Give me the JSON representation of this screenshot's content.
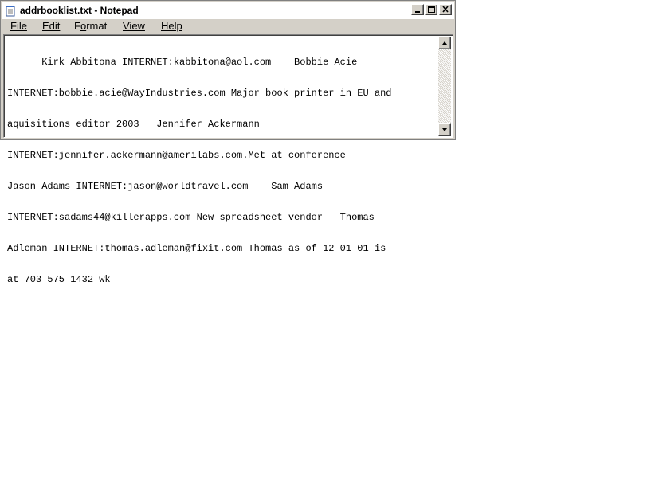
{
  "window": {
    "title": "addrbooklist.txt - Notepad",
    "controls": [
      "minimize",
      "maximize",
      "close"
    ]
  },
  "menu": [
    {
      "label": "File",
      "mnemonic_index": 0
    },
    {
      "label": "Edit",
      "mnemonic_index": 0
    },
    {
      "label": "Format",
      "mnemonic_index": 1
    },
    {
      "label": "View",
      "mnemonic_index": 0
    },
    {
      "label": "Help",
      "mnemonic_index": 0
    }
  ],
  "editor": {
    "lines": [
      "      Kirk Abbitona INTERNET:kabbitona@aol.com    Bobbie Acie",
      "INTERNET:bobbie.acie@WayIndustries.com Major book printer in EU and",
      "aquisitions editor 2003   Jennifer Ackermann",
      "INTERNET:jennifer.ackermann@amerilabs.com.Met at conference",
      "Jason Adams INTERNET:jason@worldtravel.com    Sam Adams",
      "INTERNET:sadams44@killerapps.com New spreadsheet vendor   Thomas",
      "Adleman INTERNET:thomas.adleman@fixit.com Thomas as of 12 01 01 is",
      "at 703 575 1432 wk"
    ]
  },
  "icons": {
    "app": "notepad-icon",
    "minimize": "minimize-icon",
    "maximize": "maximize-icon",
    "close": "close-icon",
    "scroll_up": "arrow-up-icon",
    "scroll_down": "arrow-down-icon"
  },
  "colors": {
    "chrome": "#d4d0c8",
    "text": "#000000",
    "editor_bg": "#ffffff"
  }
}
